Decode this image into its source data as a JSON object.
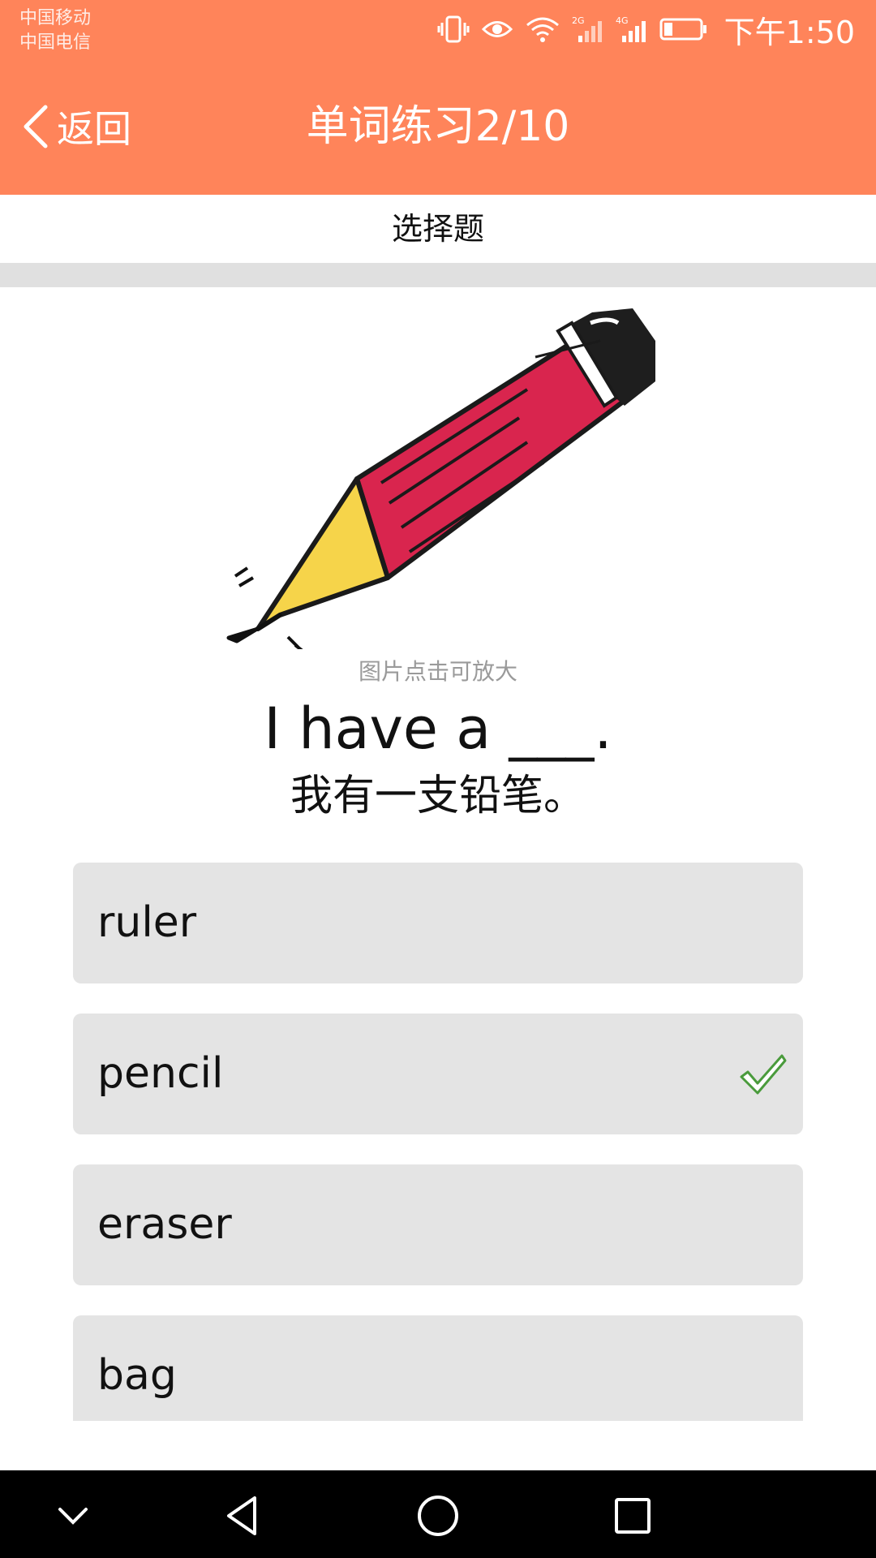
{
  "status_bar": {
    "carrier_1": "中国移动",
    "carrier_2": "中国电信",
    "network_1": "2G",
    "network_2": "4G",
    "time": "下午1:50",
    "icons": [
      "vibrate-icon",
      "eye-icon",
      "wifi-icon",
      "signal-2g-icon",
      "signal-4g-icon",
      "battery-icon"
    ]
  },
  "header": {
    "back_label": "返回",
    "title": "单词练习2/10",
    "background_color": "#ff845a"
  },
  "question": {
    "type_label": "选择题",
    "image_hint": "图片点击可放大",
    "sentence": "I have a ___.",
    "translation": "我有一支铅笔。",
    "image_icon": "pencil-illustration"
  },
  "options": [
    {
      "label": "ruler",
      "selected": false
    },
    {
      "label": "pencil",
      "selected": true
    },
    {
      "label": "eraser",
      "selected": false
    },
    {
      "label": "bag",
      "selected": false
    }
  ],
  "nav_bar": {
    "buttons": [
      "collapse-icon",
      "back-triangle-icon",
      "home-circle-icon",
      "recents-square-icon"
    ]
  }
}
